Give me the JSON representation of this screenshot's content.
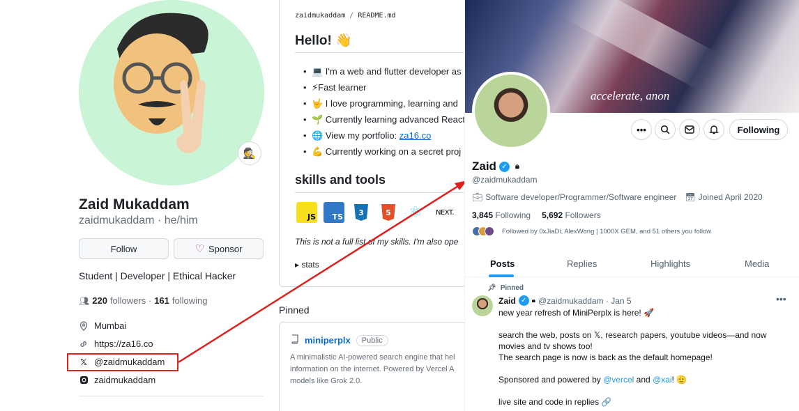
{
  "github": {
    "name": "Zaid Mukaddam",
    "handle": "zaidmukaddam · he/him",
    "status_emoji": "🕵️",
    "follow_label": "Follow",
    "sponsor_label": "Sponsor",
    "bio": "Student | Developer | Ethical Hacker",
    "followers_count": "220",
    "followers_label": "followers ·",
    "following_count": "161",
    "following_label": "following",
    "location": "Mumbai",
    "website": "https://za16.co",
    "twitter": "@zaidmukaddam",
    "instagram": "zaidmukaddam"
  },
  "readme": {
    "path_user": "zaidmukaddam",
    "path_sep": "/",
    "path_file": "README.md",
    "heading": "Hello! 👋",
    "items": [
      {
        "emoji": "💻",
        "text": " I'm a web and flutter developer as"
      },
      {
        "emoji": "⚡",
        "text": "Fast learner"
      },
      {
        "emoji": "🤟",
        "text": " I love programming, learning and "
      },
      {
        "emoji": "🌱",
        "text": " Currently learning advanced React"
      },
      {
        "emoji": "🌐",
        "text": " View my portfolio: ",
        "link": "za16.co"
      },
      {
        "emoji": "💪",
        "text": " Currently working on a secret proj"
      }
    ],
    "skills_heading": "skills and tools",
    "skills": [
      {
        "name": "JS",
        "icon": "javascript-icon"
      },
      {
        "name": "TS",
        "icon": "typescript-icon"
      },
      {
        "name": "3",
        "icon": "css3-icon"
      },
      {
        "name": "5",
        "icon": "html5-icon"
      },
      {
        "name": "⚛",
        "icon": "react-icon"
      },
      {
        "name": "NEXT.",
        "icon": "nextjs-icon"
      }
    ],
    "italic_note": "This is not a full list of my skills. I'm also ope",
    "details_label": "▸ stats"
  },
  "pinned": {
    "section_label": "Pinned",
    "repo_name": "miniperplx",
    "visibility": "Public",
    "description": "A minimalistic AI-powered search engine that hel information on the internet. Powered by Vercel A models like Grok 2.0."
  },
  "twitter": {
    "banner_text": "accelerate, anon",
    "following_label": "Following",
    "name": "Zaid",
    "handle": "@zaidmukaddam",
    "occupation": "Software developer/Programmer/Software engineer",
    "joined": "Joined April 2020",
    "following_count": "3,845",
    "following_label2": "Following",
    "followers_count": "5,692",
    "followers_label": "Followers",
    "followed_by": "Followed by 0xJiaDi, AlexWong | 1000X GEM, and 51 others you follow",
    "tabs": [
      "Posts",
      "Replies",
      "Highlights",
      "Media"
    ],
    "pinned_label": "Pinned",
    "post": {
      "author": "Zaid",
      "meta": "@zaidmukaddam · Jan 5",
      "lines": [
        "new year refresh of MiniPerplx is here! 🚀",
        "",
        "search the web, posts on 𝕏,  research papers, youtube videos—and now",
        "movies and tv shows too!",
        "The search page is now is back as the default homepage!",
        "",
        "Sponsored and powered by ",
        "",
        "live site and code in replies 🔗"
      ],
      "mention1": "@vercel",
      "and_text": " and ",
      "mention2": "@xai",
      "after_mentions": "! 🫡"
    }
  },
  "colors": {
    "highlight_red": "#e0201c",
    "github_link": "#0969da",
    "twitter_blue": "#1d9bf0"
  }
}
